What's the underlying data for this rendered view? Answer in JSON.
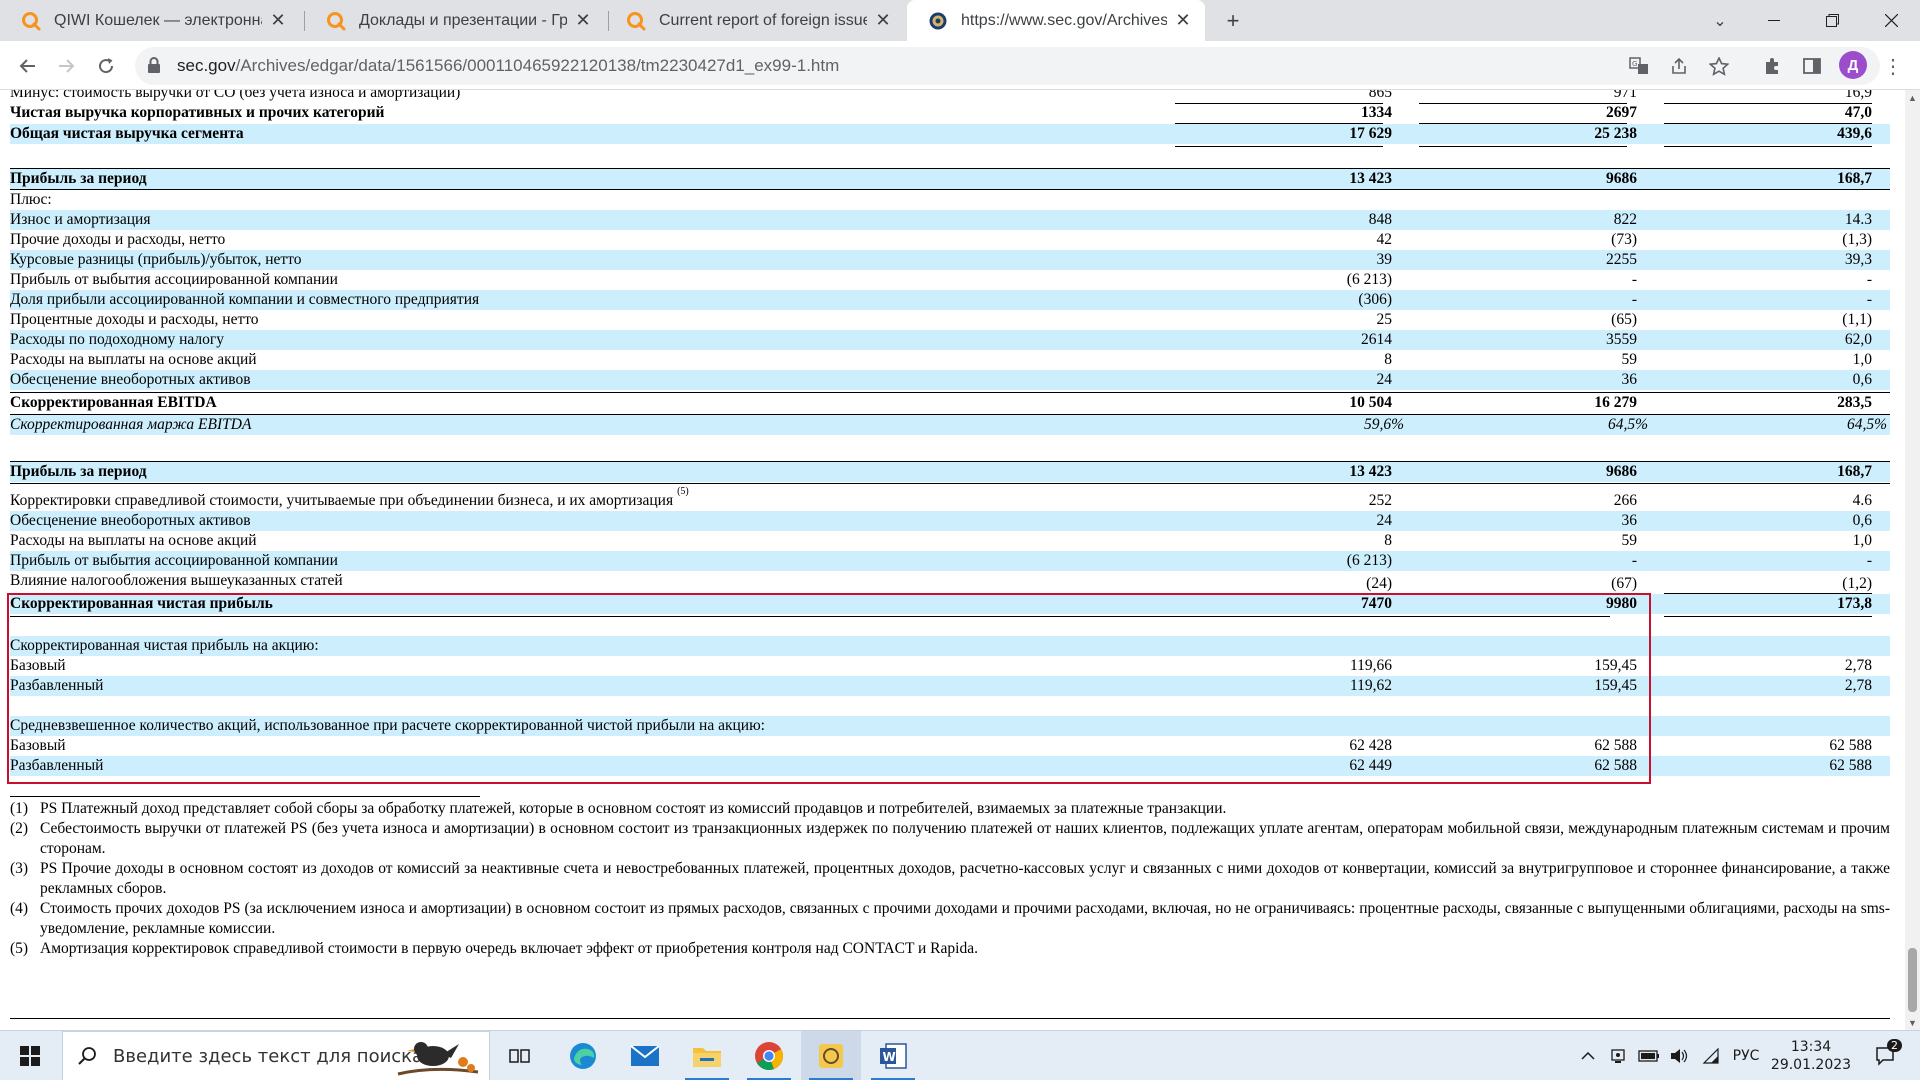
{
  "browser": {
    "tabs": [
      {
        "title": "QIWI Кошелек — электронная платежная система",
        "favicon": "qiwi-search-icon",
        "active": false
      },
      {
        "title": "Доклады и презентации - Группа QIWI",
        "favicon": "qiwi-search-icon",
        "active": false
      },
      {
        "title": "Current report of foreign issuer pursuant",
        "favicon": "qiwi-search-icon",
        "active": false
      },
      {
        "title": "https://www.sec.gov/Archives/edgar/data",
        "favicon": "sec-seal-icon",
        "active": true
      }
    ],
    "url_domain": "sec.gov",
    "url_path": "/Archives/edgar/data/1561566/000110465922120138/tm2230427d1_ex99-1.htm",
    "profile_initial": "Д"
  },
  "document": {
    "rows": [
      {
        "label": "Минус: стоимость выручки от CO (без учета износа и амортизации)",
        "c1": "865",
        "c2": "971",
        "c3": "16,9",
        "style": "plain"
      },
      {
        "label": "Чистая выручка корпоративных и прочих категорий",
        "c1": "1334",
        "c2": "2697",
        "c3": "47,0",
        "style": "bold"
      },
      {
        "label": "Общая чистая выручка сегмента",
        "c1": "17 629",
        "c2": "25 238",
        "c3": "439,6",
        "style": "bold-blue"
      },
      {
        "label": "Прибыль за период",
        "c1": "13 423",
        "c2": "9686",
        "c3": "168,7",
        "style": "bold-blue"
      },
      {
        "label": "Плюс:",
        "c1": "",
        "c2": "",
        "c3": "",
        "style": "plain"
      },
      {
        "label": "Износ и амортизация",
        "c1": "848",
        "c2": "822",
        "c3": "14.3",
        "style": "blue"
      },
      {
        "label": "Прочие доходы и расходы, нетто",
        "c1": "42",
        "c2": "(73)",
        "c3": "(1,3)",
        "style": "plain"
      },
      {
        "label": "Курсовые разницы (прибыль)/убыток, нетто",
        "c1": "39",
        "c2": "2255",
        "c3": "39,3",
        "style": "blue"
      },
      {
        "label": "Прибыль от выбытия ассоциированной компании",
        "c1": "(6 213)",
        "c2": "-",
        "c3": "-",
        "style": "plain"
      },
      {
        "label": "Доля прибыли ассоциированной компании и совместного предприятия",
        "c1": "(306)",
        "c2": "-",
        "c3": "-",
        "style": "blue"
      },
      {
        "label": "Процентные доходы и расходы, нетто",
        "c1": "25",
        "c2": "(65)",
        "c3": "(1,1)",
        "style": "plain"
      },
      {
        "label": "Расходы по подоходному налогу",
        "c1": "2614",
        "c2": "3559",
        "c3": "62,0",
        "style": "blue"
      },
      {
        "label": "Расходы на выплаты на основе акций",
        "c1": "8",
        "c2": "59",
        "c3": "1,0",
        "style": "plain"
      },
      {
        "label": "Обесценение внеоборотных активов",
        "c1": "24",
        "c2": "36",
        "c3": "0,6",
        "style": "blue"
      },
      {
        "label": "Скорректированная EBITDA",
        "c1": "10 504",
        "c2": "16 279",
        "c3": "283,5",
        "style": "bold"
      },
      {
        "label": "Скорректированная маржа EBITDA",
        "c1": "59,6%",
        "c2": "64,5%",
        "c3": "64,5%",
        "style": "italic-blue"
      },
      {
        "label": "Прибыль за период",
        "c1": "13 423",
        "c2": "9686",
        "c3": "168,7",
        "style": "bold-blue"
      },
      {
        "label": "Корректировки справедливой стоимости, учитываемые при объединении бизнеса, и их амортизация",
        "sup": "(5)",
        "c1": "252",
        "c2": "266",
        "c3": "4.6",
        "style": "plain"
      },
      {
        "label": "Обесценение внеоборотных активов",
        "c1": "24",
        "c2": "36",
        "c3": "0,6",
        "style": "blue"
      },
      {
        "label": "Расходы на выплаты на основе акций",
        "c1": "8",
        "c2": "59",
        "c3": "1,0",
        "style": "plain"
      },
      {
        "label": "Прибыль от выбытия ассоциированной компании",
        "c1": "(6 213)",
        "c2": "-",
        "c3": "-",
        "style": "blue"
      },
      {
        "label": "Влияние налогообложения вышеуказанных статей",
        "c1": "(24)",
        "c2": "(67)",
        "c3": "(1,2)",
        "style": "plain"
      },
      {
        "label": "Скорректированная чистая прибыль",
        "c1": "7470",
        "c2": "9980",
        "c3": "173,8",
        "style": "bold-blue"
      },
      {
        "label": "Скорректированная чистая прибыль на акцию:",
        "c1": "",
        "c2": "",
        "c3": "",
        "style": "blue"
      },
      {
        "label": "Базовый",
        "c1": "119,66",
        "c2": "159,45",
        "c3": "2,78",
        "style": "plain"
      },
      {
        "label": "Разбавленный",
        "c1": "119,62",
        "c2": "159,45",
        "c3": "2,78",
        "style": "blue"
      },
      {
        "label": "Средневзвешенное количество акций, использованное при расчете скорректированной чистой прибыли на акцию:",
        "c1": "",
        "c2": "",
        "c3": "",
        "style": "blue"
      },
      {
        "label": "Базовый",
        "c1": "62 428",
        "c2": "62 588",
        "c3": "62 588",
        "style": "plain"
      },
      {
        "label": "Разбавленный",
        "c1": "62 449",
        "c2": "62 588",
        "c3": "62 588",
        "style": "blue"
      }
    ],
    "footnotes": [
      {
        "num": "(1)",
        "text": "PS Платежный доход представляет собой сборы за обработку платежей, которые в основном состоят из комиссий продавцов и потребителей, взимаемых за платежные транзакции."
      },
      {
        "num": "(2)",
        "text": "Себестоимость выручки от платежей PS (без учета износа и амортизации) в основном состоит из транзакционных издержек по получению платежей от наших клиентов, подлежащих уплате агентам, операторам мобильной связи, международным платежным системам и прочим сторонам."
      },
      {
        "num": "(3)",
        "text": "PS Прочие доходы в основном состоят из доходов от комиссий за неактивные счета и невостребованных платежей, процентных доходов, расчетно-кассовых услуг и связанных с ними доходов от конвертации, комиссий за внутригрупповое и стороннее финансирование, а также рекламных сборов."
      },
      {
        "num": "(4)",
        "text": "Стоимость прочих доходов PS (за исключением износа и амортизации) в основном состоит из прямых расходов, связанных с прочими доходами и прочими расходами, включая, но не ограничиваясь: процентные расходы, связанные с выпущенными облигациями, расходы на sms-уведомление, рекламные комиссии."
      },
      {
        "num": "(5)",
        "text": "Амортизация корректировок справедливой стоимости в первую очередь включает эффект от приобретения контроля над CONTACT и Rapida."
      }
    ]
  },
  "taskbar": {
    "search_placeholder": "Введите здесь текст для поиска",
    "language": "РУС",
    "time": "13:34",
    "date": "29.01.2023",
    "notification_count": "2"
  },
  "colors": {
    "row_highlight": "#cdeefd",
    "annotation_box": "#c8102e",
    "qiwi_orange": "#f7941d",
    "profile": "#9c4dcc"
  }
}
